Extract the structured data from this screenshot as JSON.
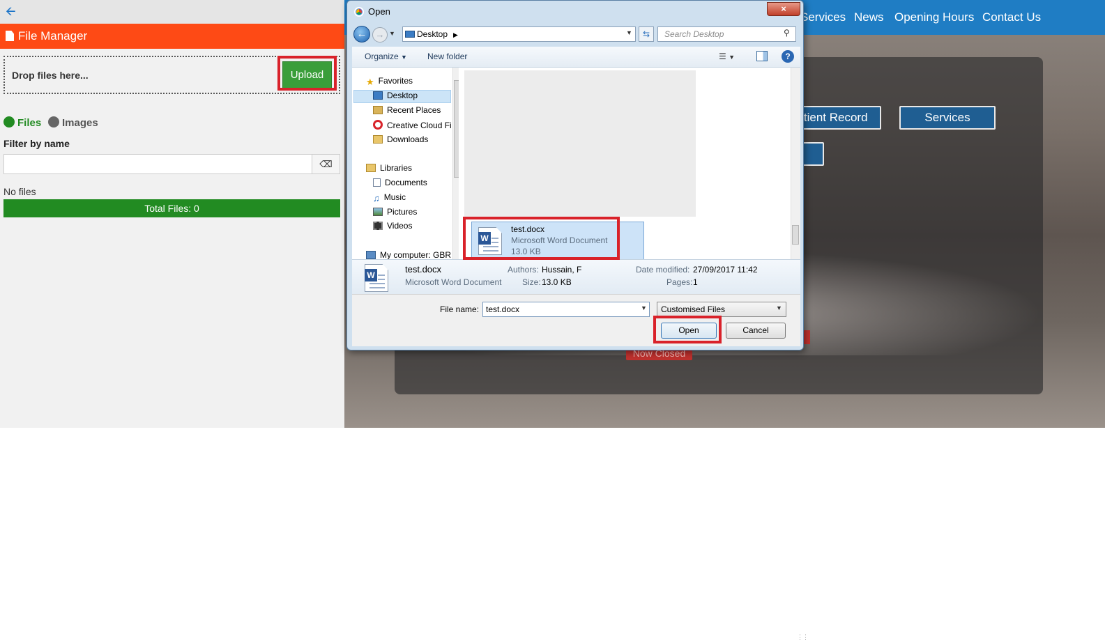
{
  "file_manager": {
    "title": "File Manager",
    "drop_label": "Drop files here...",
    "upload_label": "Upload",
    "radio_files": "Files",
    "radio_images": "Images",
    "filter_label": "Filter by name",
    "filter_value": "",
    "no_files": "No files",
    "total_files": "Total Files: 0"
  },
  "site": {
    "nav": [
      "Services",
      "News",
      "Opening Hours",
      "Contact Us"
    ],
    "buttons": [
      "atient Record",
      "Services"
    ],
    "status": "Now Closed"
  },
  "dialog": {
    "title": "Open",
    "close_icon": "×",
    "address": "Desktop",
    "search_placeholder": "Search Desktop",
    "organize": "Organize",
    "new_folder": "New folder",
    "nav_items": {
      "favorites": "Favorites",
      "desktop": "Desktop",
      "recent": "Recent Places",
      "creative": "Creative Cloud Fi",
      "downloads": "Downloads",
      "libraries": "Libraries",
      "documents": "Documents",
      "music": "Music",
      "pictures": "Pictures",
      "videos": "Videos",
      "computer": "My computer: GBR"
    },
    "file": {
      "name": "test.docx",
      "type": "Microsoft Word Document",
      "size": "13.0 KB"
    },
    "details": {
      "name": "test.docx",
      "type": "Microsoft Word Document",
      "authors_label": "Authors:",
      "authors": "Hussain, F",
      "size_label": "Size:",
      "size": "13.0 KB",
      "modified_label": "Date modified:",
      "modified": "27/09/2017 11:42",
      "pages_label": "Pages:",
      "pages": "1"
    },
    "filename_label": "File name:",
    "filename_value": "test.docx",
    "filetype": "Customised Files",
    "open_label": "Open",
    "cancel_label": "Cancel"
  },
  "colors": {
    "accent_orange": "#fe4a15",
    "success_green": "#228b22",
    "nav_blue": "#1f7dc4",
    "highlight_red": "#d9222a"
  }
}
